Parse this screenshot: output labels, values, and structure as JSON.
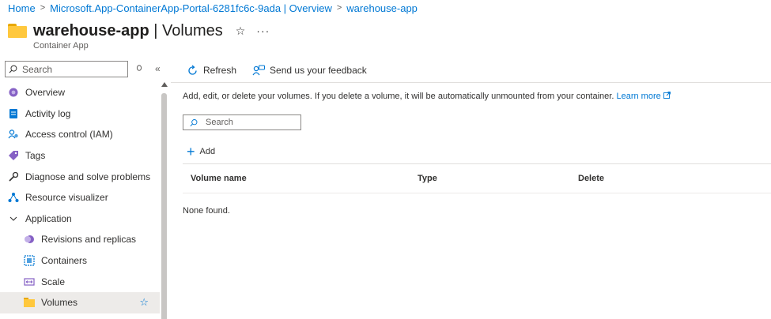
{
  "breadcrumb": [
    {
      "label": "Home"
    },
    {
      "label": "Microsoft.App-ContainerApp-Portal-6281fc6c-9ada | Overview"
    },
    {
      "label": "warehouse-app"
    }
  ],
  "header": {
    "resource_name": "warehouse-app",
    "page_name": "| Volumes",
    "subtitle": "Container App",
    "star": "☆",
    "more": "···"
  },
  "sidebar": {
    "search_placeholder": "Search",
    "items": [
      {
        "label": "Overview",
        "icon": "overview-icon"
      },
      {
        "label": "Activity log",
        "icon": "activity-log-icon"
      },
      {
        "label": "Access control (IAM)",
        "icon": "iam-icon"
      },
      {
        "label": "Tags",
        "icon": "tag-icon"
      },
      {
        "label": "Diagnose and solve problems",
        "icon": "wrench-icon"
      },
      {
        "label": "Resource visualizer",
        "icon": "visualizer-icon"
      },
      {
        "label": "Application",
        "icon": "chevron-down-icon"
      },
      {
        "label": "Revisions and replicas",
        "icon": "revisions-icon"
      },
      {
        "label": "Containers",
        "icon": "containers-icon"
      },
      {
        "label": "Scale",
        "icon": "scale-icon"
      },
      {
        "label": "Volumes",
        "icon": "folder-icon"
      }
    ]
  },
  "toolbar": {
    "refresh_label": "Refresh",
    "feedback_label": "Send us your feedback"
  },
  "main": {
    "description": "Add, edit, or delete your volumes. If you delete a volume, it will be automatically unmounted from your container.",
    "learn_more": "Learn more",
    "search_placeholder": "Search",
    "add_label": "Add",
    "columns": [
      "Volume name",
      "Type",
      "Delete"
    ],
    "empty_text": "None found."
  },
  "colors": {
    "accent": "#0078d4",
    "folder": "#ffc83d",
    "selected_bg": "#edebe9"
  }
}
